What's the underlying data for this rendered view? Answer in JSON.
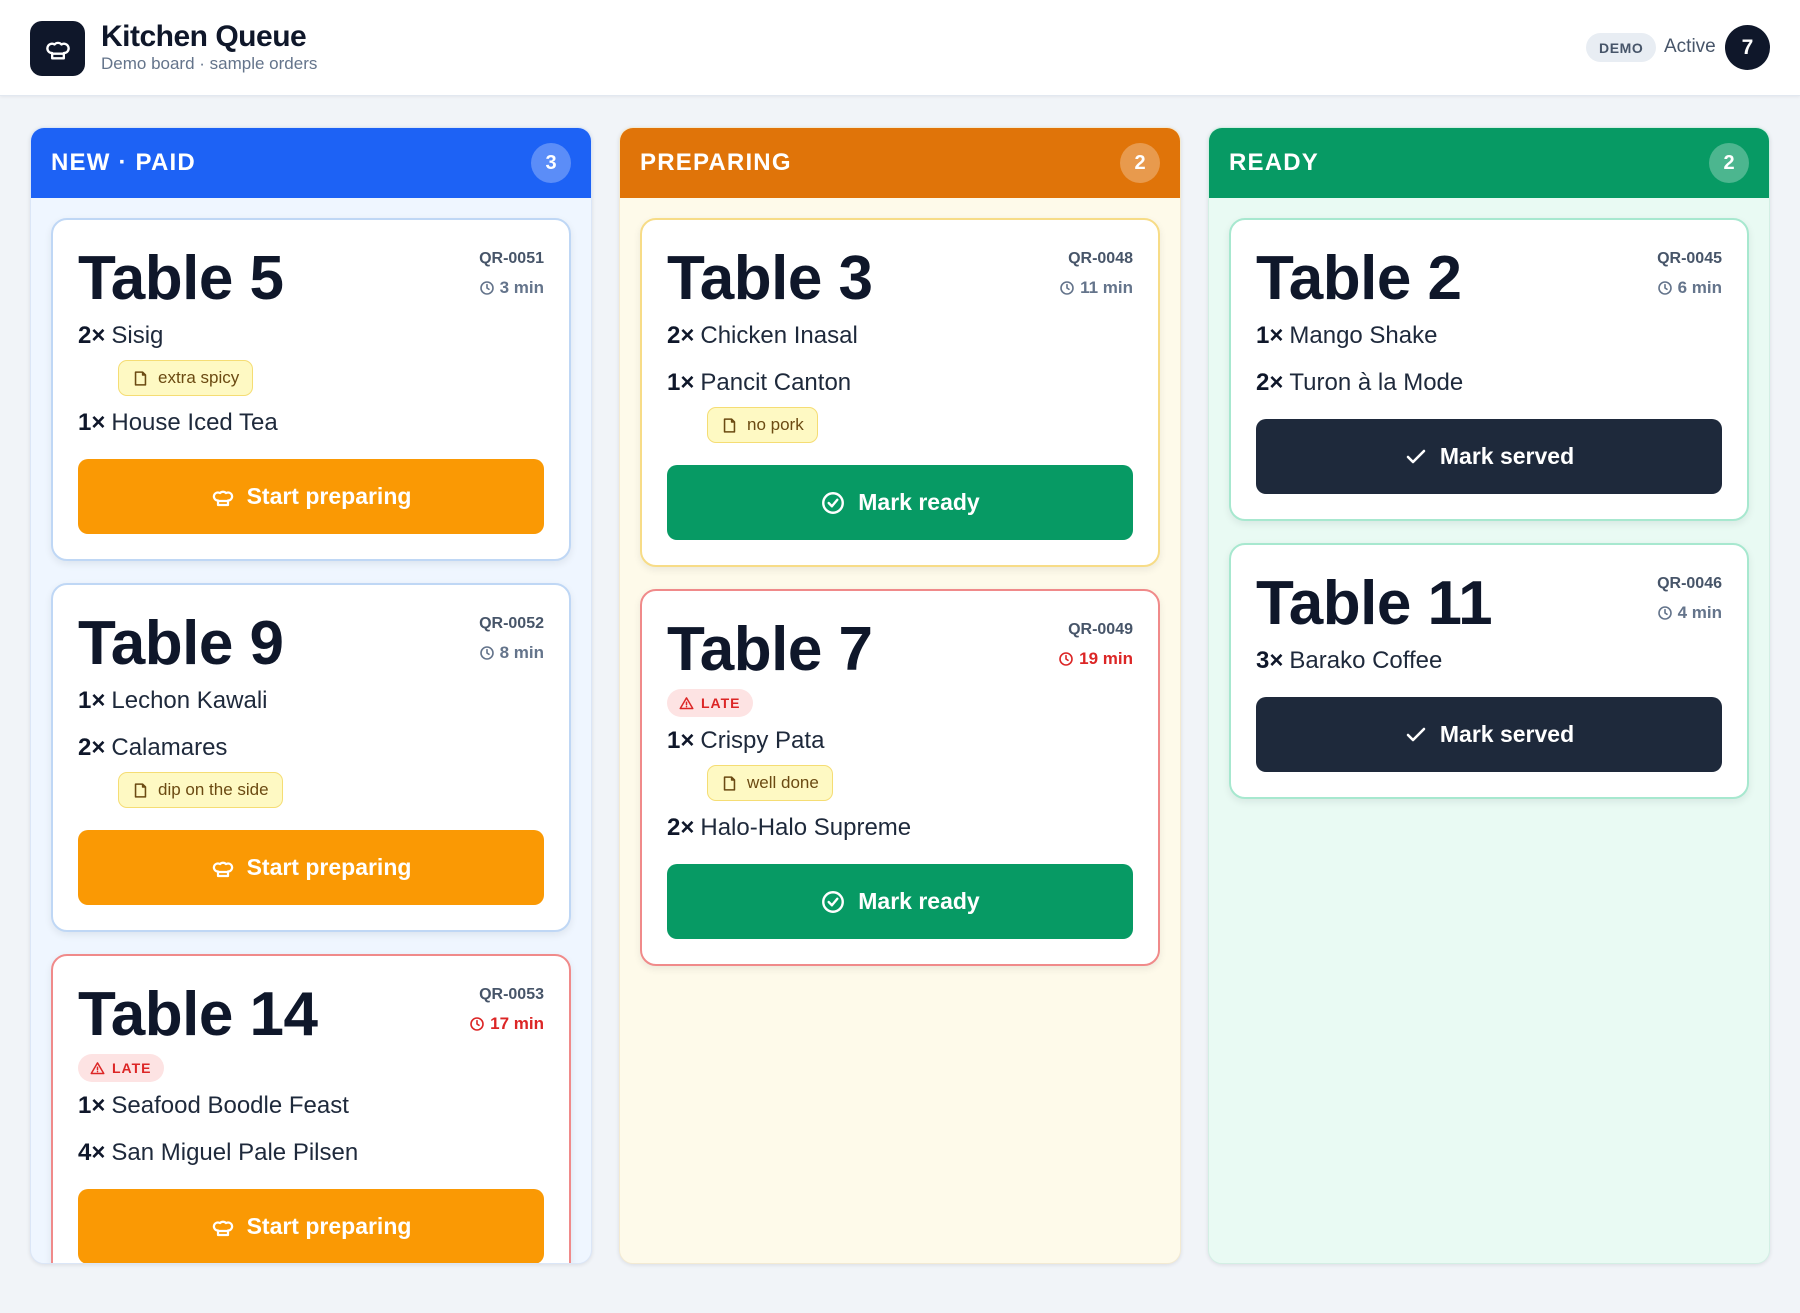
{
  "header": {
    "title": "Kitchen Queue",
    "subtitle": "Demo board · sample orders",
    "demo_badge": "DEMO",
    "active_label": "Active",
    "active_count": "7"
  },
  "colors": {
    "new": "#1d62f5",
    "preparing": "#e07409",
    "ready": "#079a64",
    "late": "#dc2626",
    "start_button": "#fa9904",
    "served_button": "#1e293b"
  },
  "columns": {
    "new": {
      "title": "NEW · PAID",
      "count": "3",
      "orders": [
        {
          "table": "Table 5",
          "qr": "QR-0051",
          "time": "3 min",
          "late": false,
          "items": [
            {
              "qty": "2×",
              "name": "Sisig",
              "note": "extra spicy"
            },
            {
              "qty": "1×",
              "name": "House Iced Tea"
            }
          ],
          "action": "Start preparing"
        },
        {
          "table": "Table 9",
          "qr": "QR-0052",
          "time": "8 min",
          "late": false,
          "items": [
            {
              "qty": "1×",
              "name": "Lechon Kawali"
            },
            {
              "qty": "2×",
              "name": "Calamares",
              "note": "dip on the side"
            }
          ],
          "action": "Start preparing"
        },
        {
          "table": "Table 14",
          "qr": "QR-0053",
          "time": "17 min",
          "late": true,
          "late_label": "LATE",
          "items": [
            {
              "qty": "1×",
              "name": "Seafood Boodle Feast"
            },
            {
              "qty": "4×",
              "name": "San Miguel Pale Pilsen"
            }
          ],
          "action": "Start preparing"
        }
      ]
    },
    "preparing": {
      "title": "PREPARING",
      "count": "2",
      "orders": [
        {
          "table": "Table 3",
          "qr": "QR-0048",
          "time": "11 min",
          "late": false,
          "items": [
            {
              "qty": "2×",
              "name": "Chicken Inasal"
            },
            {
              "qty": "1×",
              "name": "Pancit Canton",
              "note": "no pork"
            }
          ],
          "action": "Mark ready"
        },
        {
          "table": "Table 7",
          "qr": "QR-0049",
          "time": "19 min",
          "late": true,
          "late_label": "LATE",
          "items": [
            {
              "qty": "1×",
              "name": "Crispy Pata",
              "note": "well done"
            },
            {
              "qty": "2×",
              "name": "Halo-Halo Supreme"
            }
          ],
          "action": "Mark ready"
        }
      ]
    },
    "ready": {
      "title": "READY",
      "count": "2",
      "orders": [
        {
          "table": "Table 2",
          "qr": "QR-0045",
          "time": "6 min",
          "late": false,
          "items": [
            {
              "qty": "1×",
              "name": "Mango Shake"
            },
            {
              "qty": "2×",
              "name": "Turon à la Mode"
            }
          ],
          "action": "Mark served"
        },
        {
          "table": "Table 11",
          "qr": "QR-0046",
          "time": "4 min",
          "late": false,
          "items": [
            {
              "qty": "3×",
              "name": "Barako Coffee"
            }
          ],
          "action": "Mark served"
        }
      ]
    }
  }
}
